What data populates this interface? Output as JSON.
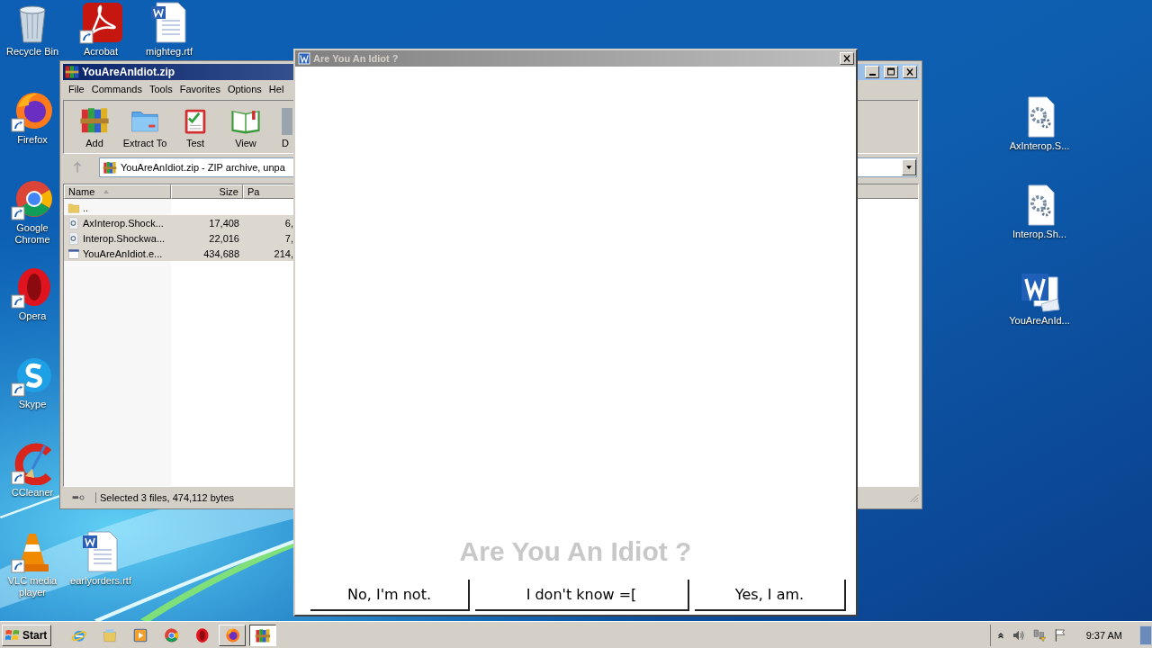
{
  "desktop_icons": [
    {
      "label": "Recycle Bin",
      "kind": "trash",
      "shortcut": false
    },
    {
      "label": "Firefox",
      "kind": "firefox",
      "shortcut": true
    },
    {
      "label": "Google Chrome",
      "kind": "chrome",
      "shortcut": true
    },
    {
      "label": "Opera",
      "kind": "opera",
      "shortcut": true
    },
    {
      "label": "Skype",
      "kind": "skype",
      "shortcut": true
    },
    {
      "label": "CCleaner",
      "kind": "ccleaner",
      "shortcut": true
    },
    {
      "label": "VLC media player",
      "kind": "vlc",
      "shortcut": true
    },
    {
      "label": "Acrobat",
      "kind": "pdf",
      "shortcut": true
    },
    {
      "label": "earlyorders.rtf",
      "kind": "doc",
      "shortcut": false
    },
    {
      "label": "mighteg.rtf",
      "kind": "doc",
      "shortcut": false
    },
    {
      "label": "AxInterop.S...",
      "kind": "gear",
      "shortcut": false
    },
    {
      "label": "Interop.Sh...",
      "kind": "gear",
      "shortcut": false
    },
    {
      "label": "YouAreAnId...",
      "kind": "word",
      "shortcut": false
    }
  ],
  "archiver_window": {
    "title": "YouAreAnIdiot.zip",
    "menu": [
      "File",
      "Commands",
      "Tools",
      "Favorites",
      "Options",
      "Hel"
    ],
    "toolbar": [
      {
        "label": "Add",
        "kind": "add"
      },
      {
        "label": "Extract To",
        "kind": "extract"
      },
      {
        "label": "Test",
        "kind": "test"
      },
      {
        "label": "View",
        "kind": "view"
      },
      {
        "label": "D",
        "kind": "delete"
      }
    ],
    "address": "YouAreAnIdiot.zip - ZIP archive, unpa",
    "columns": [
      {
        "label": "Name",
        "sorted": true
      },
      {
        "label": "Size",
        "sorted": false
      },
      {
        "label": "Pa",
        "sorted": false
      }
    ],
    "rows": [
      {
        "name": "..",
        "kind": "folder",
        "selected": false
      },
      {
        "name": "AxInterop.Shock...",
        "kind": "dll",
        "size": "17,408",
        "packed": "6,",
        "selected": true
      },
      {
        "name": "Interop.Shockwa...",
        "kind": "dll",
        "size": "22,016",
        "packed": "7,",
        "selected": true
      },
      {
        "name": "YouAreAnIdiot.e...",
        "kind": "exe",
        "size": "434,688",
        "packed": "214,",
        "selected": true
      }
    ],
    "status": "Selected 3 files, 474,112 bytes"
  },
  "dialog": {
    "title": "Are You An Idiot ?",
    "faded_text": "Are You An Idiot ?",
    "buttons": [
      "No, I'm not.",
      "I don't know =[",
      "Yes, I am."
    ]
  },
  "taskbar": {
    "start": "Start",
    "apps": [
      {
        "kind": "ie",
        "open": false,
        "selected": false
      },
      {
        "kind": "explorer",
        "open": false,
        "selected": false
      },
      {
        "kind": "media",
        "open": false,
        "selected": false
      },
      {
        "kind": "chrome",
        "open": false,
        "selected": false
      },
      {
        "kind": "opera",
        "open": false,
        "selected": false
      },
      {
        "kind": "firefox",
        "open": true,
        "selected": false
      },
      {
        "kind": "archiver",
        "open": true,
        "selected": true
      }
    ],
    "clock": "9:37 AM"
  }
}
